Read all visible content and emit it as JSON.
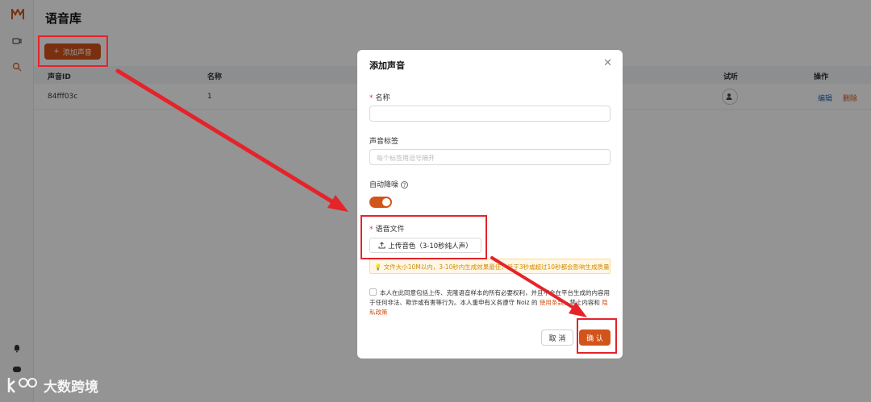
{
  "page": {
    "title": "语音库",
    "add_button": "添加声音"
  },
  "table": {
    "columns": [
      "声音ID",
      "名称",
      "试听",
      "操作"
    ],
    "rows": [
      {
        "id": "84fff03c",
        "name": "1",
        "edit": "编辑",
        "delete": "删除"
      }
    ]
  },
  "modal": {
    "title": "添加声音",
    "name_label": "名称",
    "tags_label": "声音标签",
    "tags_placeholder": "每个标签用逗号隔开",
    "denoise_label": "自动降噪",
    "denoise_on": true,
    "file_label": "语音文件",
    "upload_button": "上传音色（3-10秒纯人声）",
    "warning": "文件大小10M以内，3-10秒内生成效果最佳，低于3秒或超过10秒都会影响生成质量",
    "agree_text_1": "本人在此同意包括上传、克隆语音样本的所有必要权利，并且不会在平台生成的内容用于任何非法、欺诈或有害等行为。本人重申有义务遵守 Noiz 的",
    "agree_link_1": "使用条款",
    "agree_text_2": "，禁止内容和",
    "agree_link_2": "隐私政策",
    "cancel_button": "取 消",
    "confirm_button": "确 认"
  },
  "watermark": "大数跨境",
  "colors": {
    "accent": "#d2541b",
    "annotation": "#e5232a",
    "link": "#1e63b5"
  }
}
